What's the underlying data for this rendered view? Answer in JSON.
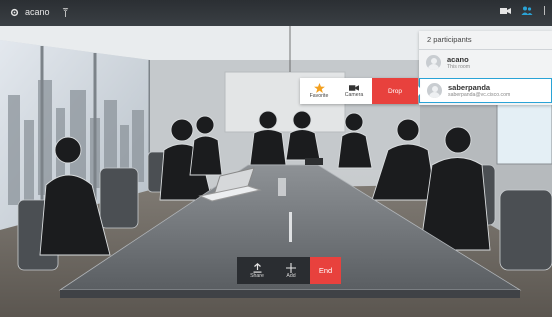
{
  "topbar": {
    "user_name": "acano",
    "left_icons": [
      "gear-icon",
      "signal-icon"
    ],
    "right_icons": [
      "camera-icon",
      "participants-icon",
      "more-icon"
    ]
  },
  "participants_panel": {
    "header": "2 participants",
    "rows": [
      {
        "name": "acano",
        "sub": "This room"
      },
      {
        "name": "saberpanda",
        "sub": "saberpanda@vc.cisco.com"
      }
    ]
  },
  "participant_menu": {
    "favorite_label": "Favorite",
    "camera_label": "Camera",
    "drop_label": "Drop"
  },
  "call_controls": {
    "share_label": "Share",
    "add_label": "Add",
    "end_label": "End"
  },
  "colors": {
    "accent_red": "#e8413d",
    "selection_blue": "#2aa3d6",
    "topbar_dark": "#2b2f33",
    "favorite_star": "#f3a01f"
  }
}
